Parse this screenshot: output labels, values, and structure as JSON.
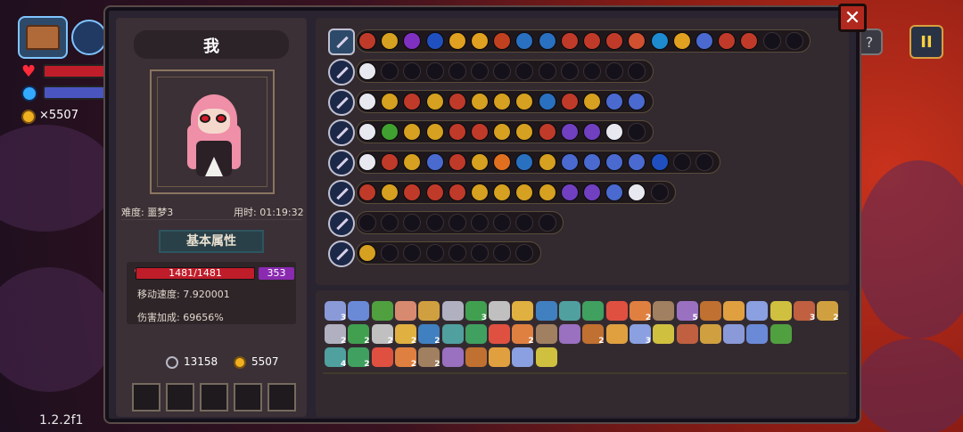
{
  "hud": {
    "coins": "×5507",
    "version": "1.2.2f1"
  },
  "player": {
    "name": "我",
    "difficulty": "难度: 噩梦3",
    "time_used": "用时: 01:19:32",
    "attr_tab": "基本属性",
    "hp": "1481/1481",
    "shield": "353",
    "move_speed": "移动速度: 7.920001",
    "damage_bonus": "伤害加成: 69656%",
    "keys": "13158",
    "gold": "5507"
  },
  "colors": {
    "panel_bg": "#2a2330",
    "hp_red": "#c01d2a",
    "shield_purple": "#8a2ab0",
    "accent_gold": "#d8a040"
  },
  "weapon_rows": [
    {
      "filled": 18,
      "total": 20,
      "colors": [
        "#c03a2a",
        "#d6a020",
        "#8030c0",
        "#2050c0",
        "#e0a020",
        "#e0a020",
        "#c04020",
        "#2a70c0",
        "#2a70c0",
        "#c03a2a",
        "#c03a2a",
        "#c03a2a",
        "#d05030",
        "#1e8ad0",
        "#e0a020",
        "#4a6ad0",
        "#c03a2a",
        "#c03a2a"
      ]
    },
    {
      "filled": 1,
      "total": 13,
      "colors": [
        "#e8e8f0"
      ]
    },
    {
      "filled": 13,
      "total": 13,
      "colors": [
        "#e8e8f0",
        "#d6a020",
        "#c03a2a",
        "#d6a020",
        "#c03a2a",
        "#d6a020",
        "#d6a020",
        "#d6a020",
        "#2a70c0",
        "#c03a2a",
        "#d6a020",
        "#4a6ad0",
        "#4a6ad0"
      ]
    },
    {
      "filled": 12,
      "total": 13,
      "colors": [
        "#e8e8f0",
        "#40a030",
        "#d6a020",
        "#d6a020",
        "#c03a2a",
        "#c03a2a",
        "#d6a020",
        "#d6a020",
        "#c03a2a",
        "#7040c0",
        "#7040c0",
        "#e8e8f0"
      ]
    },
    {
      "filled": 14,
      "total": 16,
      "colors": [
        "#e8e8f0",
        "#c03a2a",
        "#d6a020",
        "#4a6ad0",
        "#c03a2a",
        "#d6a020",
        "#e07020",
        "#2a70c0",
        "#d6a020",
        "#4a6ad0",
        "#4a6ad0",
        "#4a6ad0",
        "#4a6ad0",
        "#2050c0"
      ]
    },
    {
      "filled": 13,
      "total": 14,
      "colors": [
        "#c03a2a",
        "#d6a020",
        "#c03a2a",
        "#c03a2a",
        "#c03a2a",
        "#d6a020",
        "#d6a020",
        "#d6a020",
        "#d6a020",
        "#7040c0",
        "#7040c0",
        "#4a6ad0",
        "#e8e8f0"
      ]
    },
    {
      "filled": 0,
      "total": 9,
      "colors": []
    },
    {
      "filled": 1,
      "total": 8,
      "colors": [
        "#d6a020"
      ]
    }
  ],
  "items": [
    [
      "3",
      "",
      "",
      "",
      "",
      "",
      "3",
      "",
      "",
      "",
      "",
      "",
      "",
      "2",
      "",
      "5",
      "",
      "",
      "",
      "",
      "3",
      "2"
    ],
    [
      "2",
      "2",
      "2",
      "2",
      "2",
      "",
      "",
      "",
      "2",
      "",
      "",
      "2",
      "",
      "3",
      "",
      "",
      "",
      "",
      "",
      ""
    ],
    [
      "4",
      "2",
      "",
      "2",
      "2",
      "",
      "",
      "",
      "",
      ""
    ]
  ]
}
